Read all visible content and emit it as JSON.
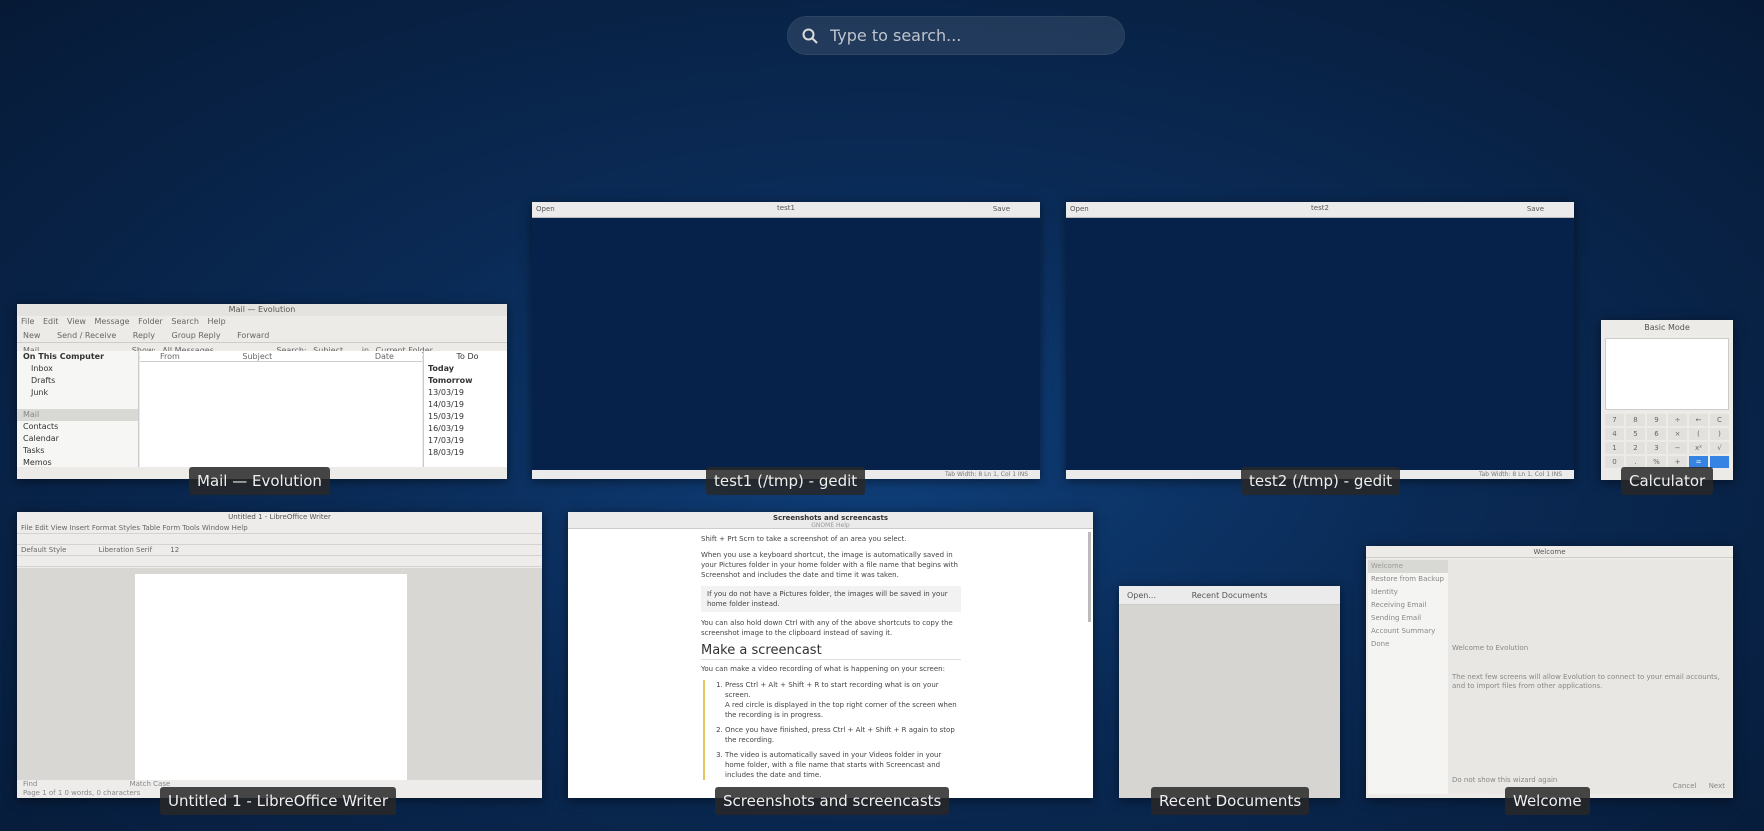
{
  "search": {
    "placeholder": "Type to search..."
  },
  "windows": {
    "evolution": {
      "caption": "Mail — Evolution",
      "title": "Mail — Evolution",
      "menu": [
        "File",
        "Edit",
        "View",
        "Message",
        "Folder",
        "Search",
        "Help"
      ],
      "toolbar": [
        "New",
        "Send / Receive",
        "Reply",
        "Group Reply",
        "Forward"
      ],
      "show_label": "Show:",
      "show_value": "All Messages",
      "search_label": "Search:",
      "search_value": "Subject ...",
      "in_label": "in",
      "in_value": "Current Folder",
      "folder_header": "Mail",
      "folders": [
        "On This Computer",
        "Inbox",
        "Drafts",
        "Junk"
      ],
      "columns": [
        "From",
        "Subject",
        "Date"
      ],
      "sections": [
        "Mail",
        "Contacts",
        "Calendar",
        "Tasks",
        "Memos"
      ],
      "todo_header": "To Do",
      "todo": [
        "Today",
        "Tomorrow",
        "13/03/19",
        "14/03/19",
        "15/03/19",
        "16/03/19",
        "17/03/19",
        "18/03/19"
      ]
    },
    "gedit1": {
      "caption": "test1 (/tmp) - gedit",
      "title": "test1",
      "open": "Open",
      "save": "Save",
      "status": "Tab Width: 8     Ln 1, Col 1     INS"
    },
    "gedit2": {
      "caption": "test2 (/tmp) - gedit",
      "title": "test2",
      "open": "Open",
      "save": "Save",
      "status": "Tab Width: 8     Ln 1, Col 1     INS"
    },
    "calculator": {
      "caption": "Calculator",
      "title": "Basic Mode",
      "keys": [
        "7",
        "8",
        "9",
        "÷",
        "←",
        "C",
        "4",
        "5",
        "6",
        "×",
        "(",
        ")",
        "1",
        "2",
        "3",
        "−",
        "x²",
        "√",
        "0",
        ".",
        "%",
        "+",
        "=",
        ""
      ]
    },
    "writer": {
      "caption": "Untitled 1 - LibreOffice Writer",
      "title": "Untitled 1 - LibreOffice Writer",
      "menu": "File  Edit  View  Insert  Format  Styles  Table  Form  Tools  Window  Help",
      "style": "Default Style",
      "font": "Liberation Serif",
      "size": "12",
      "find": "Find",
      "match_case": "Match Case",
      "status": "Page 1 of 1     0 words, 0 characters"
    },
    "help": {
      "caption": "Screenshots and screencasts",
      "title": "Screenshots and screencasts",
      "subtitle": "GNOME Help",
      "line1": "Shift + Prt Scrn to take a screenshot of an area you select.",
      "p1": "When you use a keyboard shortcut, the image is automatically saved in your Pictures folder in your home folder with a file name that begins with Screenshot and includes the date and time it was taken.",
      "note": "If you do not have a Pictures folder, the images will be saved in your home folder instead.",
      "p2": "You can also hold down Ctrl with any of the above shortcuts to copy the screenshot image to the clipboard instead of saving it.",
      "h2": "Make a screencast",
      "p3": "You can make a video recording of what is happening on your screen:",
      "steps": [
        "Press Ctrl + Alt + Shift + R to start recording what is on your screen.",
        "Once you have finished, press Ctrl + Alt + Shift + R again to stop the recording.",
        "The video is automatically saved in your Videos folder in your home folder, with a file name that starts with Screencast and includes the date and time."
      ],
      "step1_note": "A red circle is displayed in the top right corner of the screen when the recording is in progress."
    },
    "recent": {
      "caption": "Recent Documents",
      "title": "Recent Documents",
      "open": "Open..."
    },
    "welcome": {
      "caption": "Welcome",
      "title": "Welcome",
      "nav": [
        "Welcome",
        "Restore from Backup",
        "Identity",
        "Receiving Email",
        "Sending Email",
        "Account Summary",
        "Done"
      ],
      "heading": "Welcome to Evolution",
      "text": "The next few screens will allow Evolution to connect to your email accounts, and to import files from other applications.",
      "checkbox": "Do not show this wizard again",
      "cancel": "Cancel",
      "next": "Next"
    }
  }
}
